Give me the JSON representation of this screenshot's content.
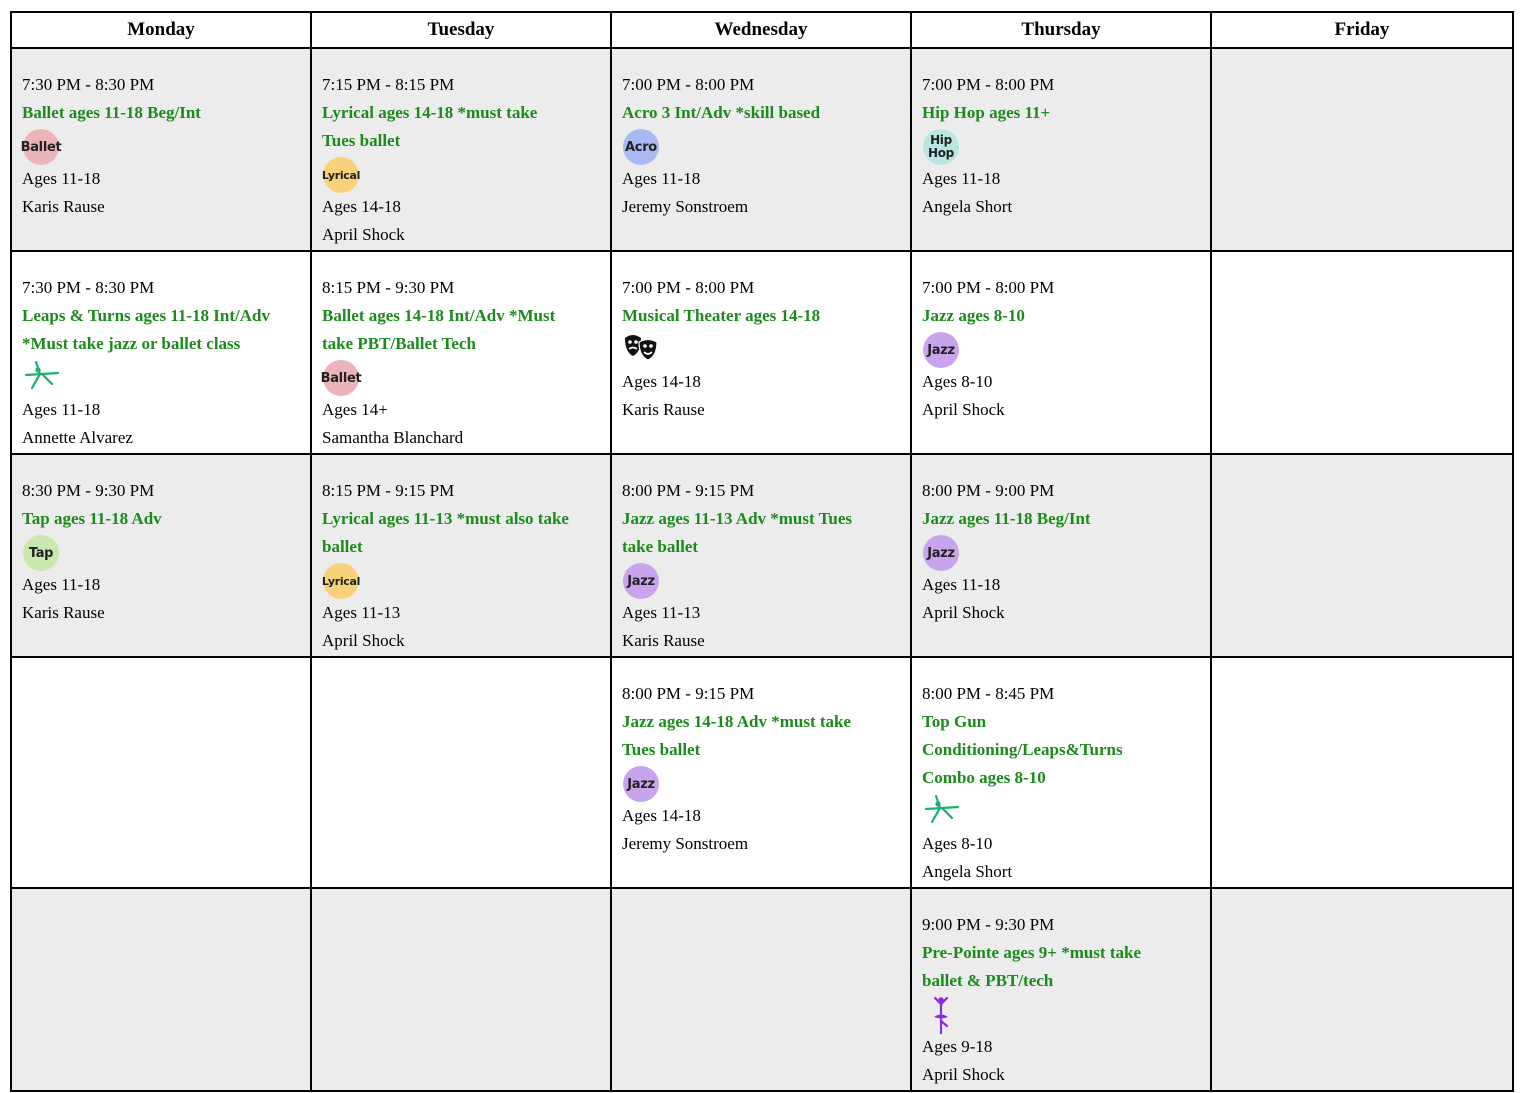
{
  "days": [
    "Monday",
    "Tuesday",
    "Wednesday",
    "Thursday",
    "Friday"
  ],
  "rows": [
    {
      "cells": [
        {
          "time": "7:30 PM - 8:30 PM",
          "title_lines": [
            "Ballet ages 11-18 Beg/Int"
          ],
          "icon": "ballet-badge-icon",
          "badge": "Ballet",
          "ages": "Ages 11-18",
          "instructor": "Karis Rause"
        },
        {
          "time": "7:15 PM - 8:15 PM",
          "title_lines": [
            "Lyrical ages 14-18 *must take",
            "Tues ballet"
          ],
          "icon": "lyrical-badge-icon",
          "badge": "Lyrical",
          "ages": "Ages 14-18",
          "instructor": "April  Shock"
        },
        {
          "time": "7:00 PM - 8:00 PM",
          "title_lines": [
            "Acro 3 Int/Adv *skill based"
          ],
          "icon": "acro-badge-icon",
          "badge": "Acro",
          "ages": "Ages 11-18",
          "instructor": "Jeremy Sonstroem"
        },
        {
          "time": "7:00 PM - 8:00 PM",
          "title_lines": [
            "Hip Hop ages 11+"
          ],
          "icon": "hip-hop-badge-icon",
          "badge": "Hip\nHop",
          "ages": "Ages 11-18",
          "instructor": "Angela  Short"
        },
        null
      ]
    },
    {
      "cells": [
        {
          "time": "7:30 PM - 8:30 PM",
          "title_lines": [
            "Leaps & Turns ages 11-18 Int/Adv",
            "*Must take jazz or ballet class"
          ],
          "icon": "leaping-dancer-icon",
          "ages": "Ages 11-18",
          "instructor": "Annette  Alvarez"
        },
        {
          "time": "8:15 PM - 9:30 PM",
          "title_lines": [
            "Ballet ages 14-18 Int/Adv *Must",
            "take PBT/Ballet Tech"
          ],
          "icon": "ballet-badge-icon",
          "badge": "Ballet",
          "ages": "Ages 14+",
          "instructor": "Samantha Blanchard"
        },
        {
          "time": "7:00 PM - 8:00 PM",
          "title_lines": [
            "Musical Theater ages 14-18"
          ],
          "icon": "theater-masks-icon",
          "ages": "Ages 14-18",
          "instructor": "Karis Rause"
        },
        {
          "time": "7:00 PM - 8:00 PM",
          "title_lines": [
            "Jazz ages 8-10"
          ],
          "icon": "jazz-badge-icon",
          "badge": "Jazz",
          "ages": "Ages 8-10",
          "instructor": "April  Shock"
        },
        null
      ]
    },
    {
      "cells": [
        {
          "time": "8:30 PM - 9:30 PM",
          "title_lines": [
            "Tap ages 11-18 Adv"
          ],
          "icon": "tap-badge-icon",
          "badge": "Tap",
          "ages": "Ages 11-18",
          "instructor": "Karis Rause"
        },
        {
          "time": "8:15 PM - 9:15 PM",
          "title_lines": [
            "Lyrical ages 11-13 *must also take",
            "ballet"
          ],
          "icon": "lyrical-badge-icon",
          "badge": "Lyrical",
          "ages": "Ages 11-13",
          "instructor": "April  Shock"
        },
        {
          "time": "8:00 PM - 9:15 PM",
          "title_lines": [
            "Jazz ages 11-13 Adv *must Tues",
            "take ballet"
          ],
          "icon": "jazz-badge-icon",
          "badge": "Jazz",
          "ages": "Ages 11-13",
          "instructor": "Karis Rause"
        },
        {
          "time": "8:00 PM - 9:00 PM",
          "title_lines": [
            "Jazz ages 11-18 Beg/Int"
          ],
          "icon": "jazz-badge-icon",
          "badge": "Jazz",
          "ages": "Ages 11-18",
          "instructor": "April  Shock"
        },
        null
      ]
    },
    {
      "cells": [
        null,
        null,
        {
          "time": "8:00 PM - 9:15 PM",
          "title_lines": [
            "Jazz ages 14-18 Adv *must take",
            "Tues ballet"
          ],
          "icon": "jazz-badge-icon",
          "badge": "Jazz",
          "ages": "Ages 14-18",
          "instructor": "Jeremy Sonstroem"
        },
        {
          "time": "8:00 PM - 8:45 PM",
          "title_lines": [
            "Top Gun",
            "Conditioning/Leaps&Turns",
            "Combo ages 8-10"
          ],
          "icon": "leaping-dancer-icon",
          "ages": "Ages 8-10",
          "instructor": "Angela  Short"
        },
        null
      ]
    },
    {
      "cells": [
        null,
        null,
        null,
        {
          "time": "9:00 PM - 9:30 PM",
          "title_lines": [
            "Pre-Pointe ages 9+ *must take",
            "ballet & PBT/tech"
          ],
          "icon": "ballerina-icon",
          "ages": "Ages 9-18",
          "instructor": "April  Shock"
        },
        null
      ]
    }
  ],
  "colors": {
    "title_green": "#1c8a1c",
    "shaded_row": "#ececec",
    "ballet": "#eab4b8",
    "lyrical": "#f7d27a",
    "acro": "#a9b9f2",
    "hip_hop": "#b9e6e0",
    "jazz": "#c8a4ec",
    "tap": "#c9e8b0",
    "leaping_dancer": "#18b36b",
    "ballerina": "#8a2be2"
  }
}
